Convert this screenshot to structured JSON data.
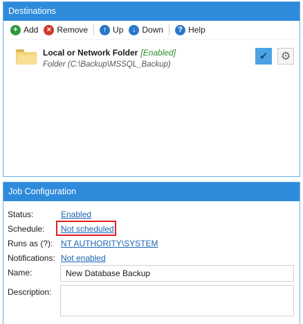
{
  "destinations": {
    "header": "Destinations",
    "toolbar": {
      "add": "Add",
      "remove": "Remove",
      "up": "Up",
      "down": "Down",
      "help": "Help"
    },
    "item": {
      "title": "Local or Network Folder",
      "status": "[Enabled]",
      "path": "Folder (C:\\Backup\\MSSQL_Backup)"
    }
  },
  "job": {
    "header": "Job Configuration",
    "status_label": "Status:",
    "status_value": "Enabled",
    "schedule_label": "Schedule:",
    "schedule_value": "Not scheduled",
    "runas_label": "Runs as (?):",
    "runas_value": "NT AUTHORITY\\SYSTEM",
    "notifications_label": "Notifications:",
    "notifications_value": "Not enabled",
    "name_label": "Name:",
    "name_value": "New Database Backup",
    "description_label": "Description:",
    "description_value": ""
  },
  "colors": {
    "header_bg": "#2e8bdb",
    "link": "#1a63b4",
    "enabled_green": "#2f8a2f",
    "highlight_red": "#e02020"
  },
  "icons": [
    "add-icon",
    "remove-icon",
    "up-icon",
    "down-icon",
    "help-icon",
    "folder-icon",
    "check-icon",
    "gear-icon"
  ]
}
